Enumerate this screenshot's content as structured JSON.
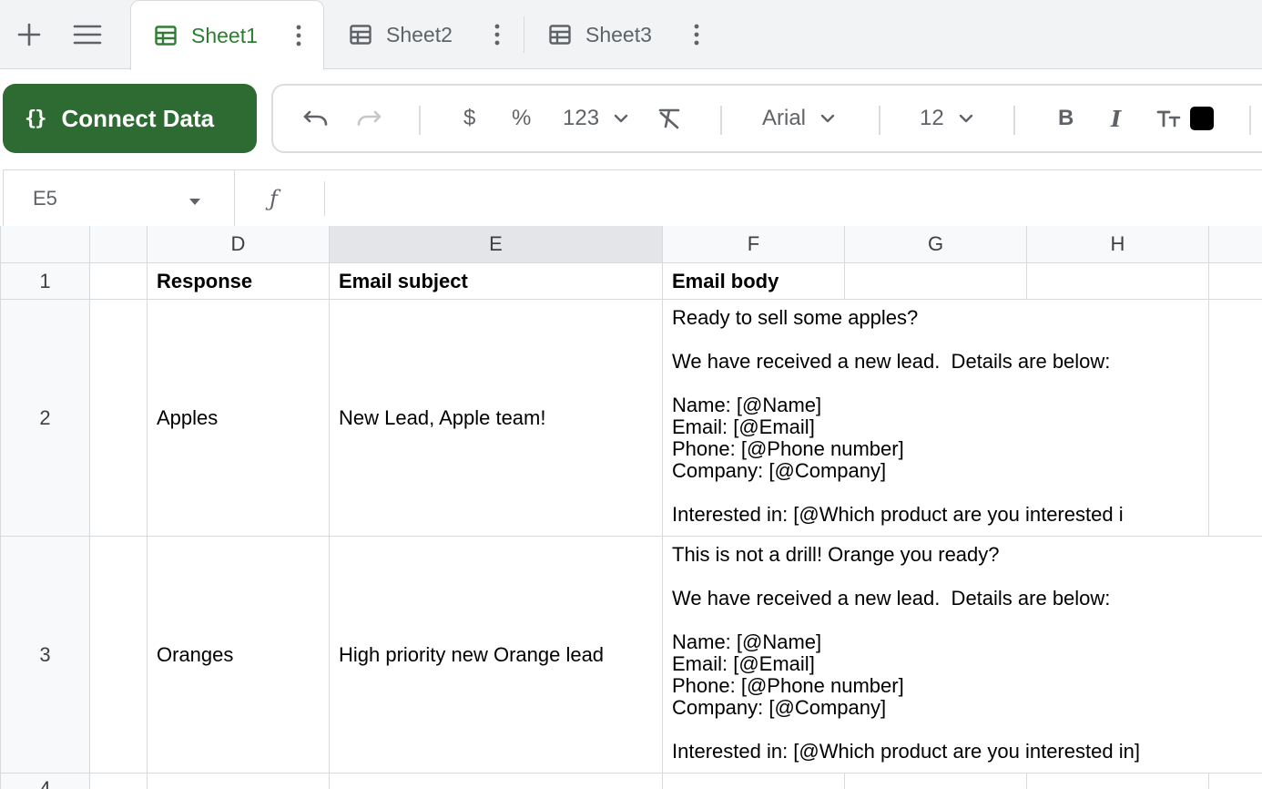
{
  "tabs": [
    {
      "label": "Sheet1",
      "active": true
    },
    {
      "label": "Sheet2",
      "active": false
    },
    {
      "label": "Sheet3",
      "active": false
    }
  ],
  "toolbar": {
    "connect_label": "Connect Data",
    "connect_brace": "{}",
    "currency": "$",
    "percent": "%",
    "number_format": "123",
    "font": "Arial",
    "font_size": "12",
    "bold": "B",
    "italic": "I",
    "text_color": "#000000"
  },
  "formula_bar": {
    "cell_ref": "E5",
    "fx": "ƒ"
  },
  "sheet": {
    "columns": [
      "D",
      "E",
      "F",
      "G",
      "H"
    ],
    "rows": [
      {
        "num": "1",
        "D": "Response",
        "E": "Email subject",
        "F": "Email body"
      },
      {
        "num": "2",
        "D": "Apples",
        "E": "New Lead, Apple team!",
        "F": [
          "Ready to sell some apples?",
          "",
          "We have received a new lead.  Details are below:",
          "",
          "Name: [@Name]",
          "Email: [@Email]",
          "Phone: [@Phone number]",
          "Company: [@Company]",
          "",
          "Interested in: [@Which product are you interested i"
        ]
      },
      {
        "num": "3",
        "D": "Oranges",
        "E": "High priority new Orange lead",
        "F": [
          "This is not a drill! Orange you ready?",
          "",
          "We have received a new lead.  Details are below:",
          "",
          "Name: [@Name]",
          "Email: [@Email]",
          "Phone: [@Phone number]",
          "Company: [@Company]",
          "",
          "Interested in: [@Which product are you interested in]"
        ]
      },
      {
        "num": "4"
      }
    ]
  },
  "colors": {
    "accent": "#2e6b32",
    "active_tab_text": "#2e7d32",
    "grid_line": "#d7dadd"
  }
}
